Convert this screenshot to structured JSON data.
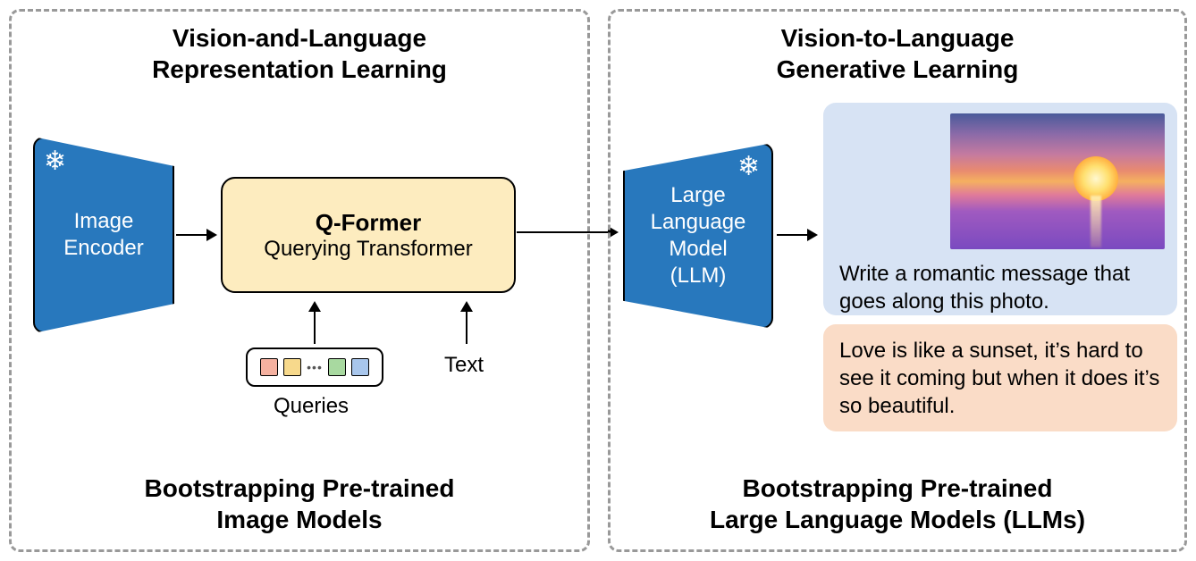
{
  "left": {
    "title_line1": "Vision-and-Language",
    "title_line2": "Representation Learning",
    "encoder_label": "Image\nEncoder",
    "qformer_title": "Q-Former",
    "qformer_sub": "Querying Transformer",
    "queries_label": "Queries",
    "text_label": "Text",
    "footer_line1": "Bootstrapping Pre-trained",
    "footer_line2": "Image Models",
    "query_colors": [
      "#f5b1a0",
      "#f7d98c",
      "#a8d9a0",
      "#a8c6ec"
    ]
  },
  "right": {
    "title_line1": "Vision-to-Language",
    "title_line2": "Generative Learning",
    "llm_label": "Large\nLanguage\nModel\n(LLM)",
    "prompt_text": "Write a romantic message that goes along this photo.",
    "response_text": "Love is like a sunset, it’s hard to see it coming but when it does it’s so beautiful.",
    "footer_line1": "Bootstrapping Pre-trained",
    "footer_line2": "Large Language Models (LLMs)"
  }
}
